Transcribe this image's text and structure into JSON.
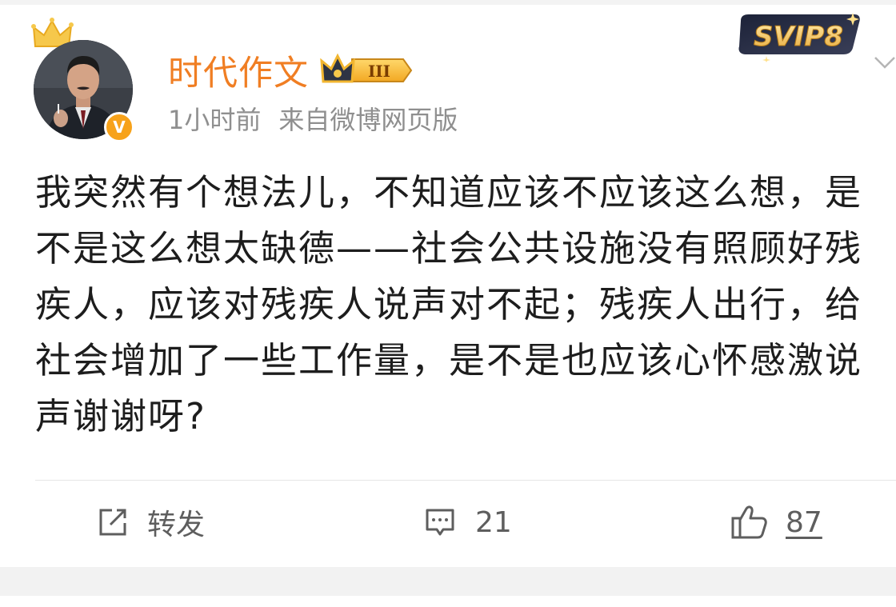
{
  "post": {
    "author": {
      "name": "时代作文",
      "level_badge": "III",
      "verified_badge": "V",
      "avatar": "portrait-photo"
    },
    "meta": {
      "time": "1小时前",
      "source": "来自微博网页版"
    },
    "vip_badge": "SVIP8",
    "text": "我突然有个想法儿，不知道应该不应该这么想，是不是这么想太缺德——社会公共设施没有照顾好残疾人，应该对残疾人说声对不起；残疾人出行，给社会增加了一些工作量，是不是也应该心怀感激说声谢谢呀?",
    "actions": {
      "repost_label": "转发",
      "comment_count": "21",
      "like_count": "87"
    }
  },
  "icons": {
    "crown": "crown-icon",
    "repost": "repost-icon",
    "comment": "comment-icon",
    "like": "thumbs-up-icon",
    "menu": "chevron-down-icon"
  },
  "colors": {
    "name": "#f07e23",
    "meta": "#8f8f8f",
    "text": "#1d1d1d",
    "action": "#5e5e5e",
    "badge_gold": "#f7a21a"
  }
}
